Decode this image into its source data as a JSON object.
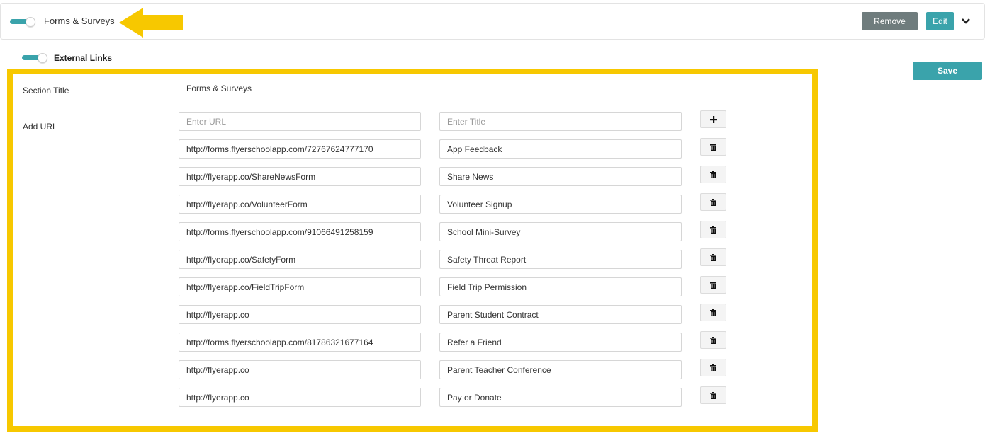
{
  "header": {
    "title": "Forms & Surveys",
    "remove_label": "Remove",
    "edit_label": "Edit",
    "toggle_on": true
  },
  "sub_section": {
    "title": "External Links",
    "toggle_on": true,
    "save_label": "Save"
  },
  "form": {
    "section_title_label": "Section Title",
    "section_title_value": "Forms & Surveys",
    "add_url_label": "Add URL",
    "url_placeholder": "Enter URL",
    "title_placeholder": "Enter Title",
    "links": [
      {
        "url": "http://forms.flyerschoolapp.com/72767624777170",
        "title": "App Feedback"
      },
      {
        "url": "http://flyerapp.co/ShareNewsForm",
        "title": "Share News"
      },
      {
        "url": "http://flyerapp.co/VolunteerForm",
        "title": "Volunteer Signup"
      },
      {
        "url": "http://forms.flyerschoolapp.com/91066491258159",
        "title": "School Mini-Survey"
      },
      {
        "url": "http://flyerapp.co/SafetyForm",
        "title": "Safety Threat Report"
      },
      {
        "url": "http://flyerapp.co/FieldTripForm",
        "title": "Field Trip Permission"
      },
      {
        "url": "http://flyerapp.co",
        "title": "Parent Student Contract"
      },
      {
        "url": "http://forms.flyerschoolapp.com/81786321677164",
        "title": "Refer a Friend"
      },
      {
        "url": "http://flyerapp.co",
        "title": "Parent Teacher Conference"
      },
      {
        "url": "http://flyerapp.co",
        "title": "Pay or Donate"
      }
    ]
  },
  "icons": {
    "add": "plus-icon",
    "delete": "trash-icon",
    "collapse": "chevron-down-icon",
    "annotation": "arrow-left-icon"
  },
  "colors": {
    "accent": "#3aa3ab",
    "remove_button": "#6f7c7d",
    "highlight": "#f7c800"
  }
}
